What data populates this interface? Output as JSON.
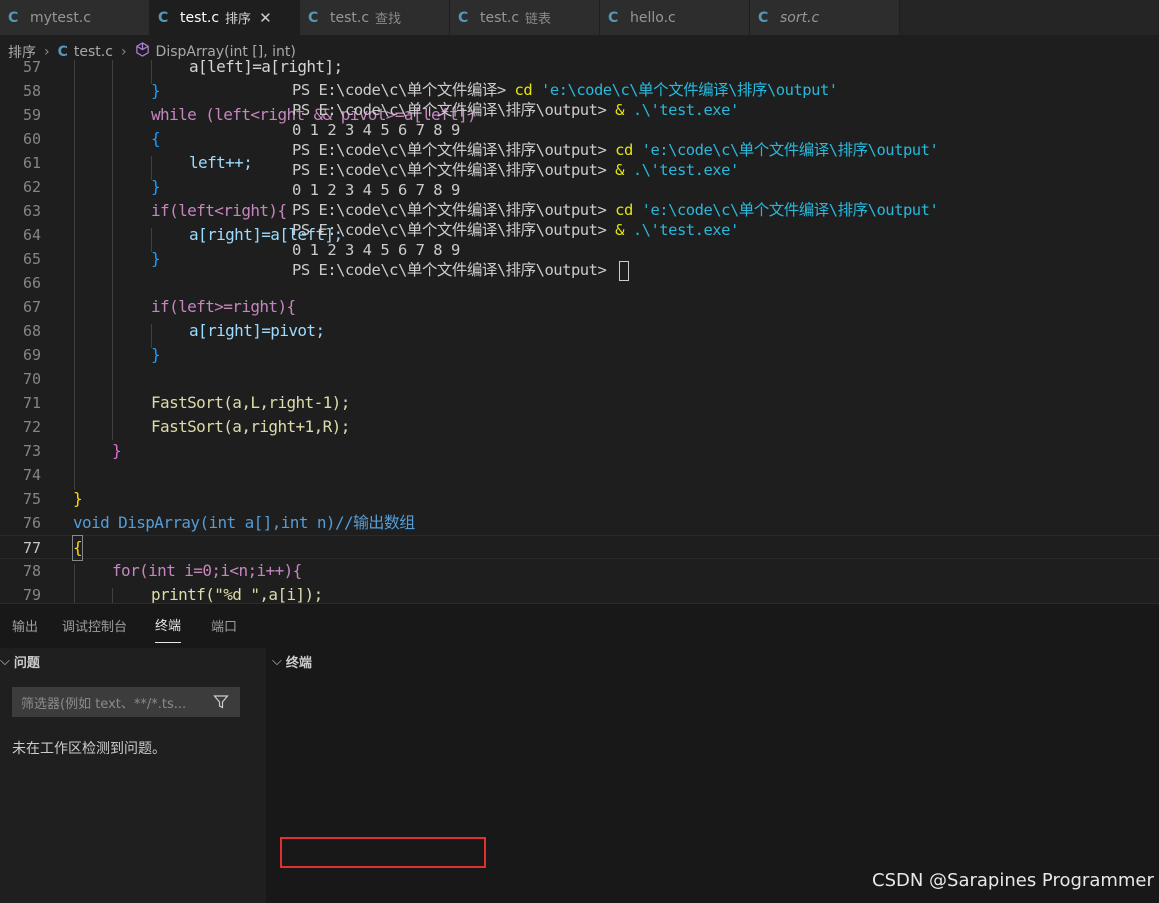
{
  "tabs": [
    {
      "icon": "C",
      "name": "mytest.c",
      "desc": "",
      "active": false,
      "italic": false
    },
    {
      "icon": "C",
      "name": "test.c",
      "desc": "排序",
      "active": true,
      "italic": false,
      "close": "✕"
    },
    {
      "icon": "C",
      "name": "test.c",
      "desc": "查找",
      "active": false,
      "italic": false
    },
    {
      "icon": "C",
      "name": "test.c",
      "desc": "链表",
      "active": false,
      "italic": false
    },
    {
      "icon": "C",
      "name": "hello.c",
      "desc": "",
      "active": false,
      "italic": false
    },
    {
      "icon": "C",
      "name": "sort.c",
      "desc": "",
      "active": false,
      "italic": true
    }
  ],
  "breadcrumb": {
    "folder": "排序",
    "file_icon": "C",
    "file": "test.c",
    "symbol": "DispArray(int [], int)"
  },
  "editor": {
    "line_numbers": [
      "57",
      "58",
      "59",
      "60",
      "61",
      "62",
      "63",
      "64",
      "65",
      "66",
      "67",
      "68",
      "69",
      "70",
      "71",
      "72",
      "73",
      "74",
      "75",
      "76",
      "77",
      "78",
      "79"
    ],
    "current_line": "77",
    "lines": [
      "a[left]=a[right];",
      "}",
      "while (left<right && pivot>=a[left])",
      "{",
      "left++;",
      "}",
      "if(left<right){",
      "a[right]=a[left];",
      "}",
      "",
      "if(left>=right){",
      "a[right]=pivot;",
      "}",
      "",
      "FastSort(a,L,right-1);",
      "FastSort(a,right+1,R);",
      "}",
      "",
      "}",
      "void DispArray(int a[],int n)//输出数组",
      "{",
      "for(int i=0;i<n;i++){",
      "printf(\"%d \",a[i]);"
    ]
  },
  "panel": {
    "tabs": [
      "输出",
      "调试控制台",
      "终端",
      "端口"
    ],
    "active_tab": "终端",
    "problems_header": "问题",
    "terminal_header": "终端",
    "filter_placeholder": "筛选器(例如 text、**/*.ts...",
    "no_problems": "未在工作区检测到问题。",
    "terminal_lines": [
      {
        "prompt": "PS E:\\code\\c\\单个文件编译> ",
        "cmd": "cd",
        "arg": " 'e:\\code\\c\\单个文件编译\\排序\\output'"
      },
      {
        "prompt": "PS E:\\code\\c\\单个文件编译\\排序\\output> ",
        "cmd": "&",
        "arg": " .\\'test.exe'"
      },
      {
        "prompt": "0 1 2 3 4 5 6 7 8 9",
        "cmd": "",
        "arg": ""
      },
      {
        "prompt": "PS E:\\code\\c\\单个文件编译\\排序\\output> ",
        "cmd": "cd",
        "arg": " 'e:\\code\\c\\单个文件编译\\排序\\output'"
      },
      {
        "prompt": "PS E:\\code\\c\\单个文件编译\\排序\\output> ",
        "cmd": "&",
        "arg": " .\\'test.exe'"
      },
      {
        "prompt": "0 1 2 3 4 5 6 7 8 9",
        "cmd": "",
        "arg": ""
      },
      {
        "prompt": "PS E:\\code\\c\\单个文件编译\\排序\\output> ",
        "cmd": "cd",
        "arg": " 'e:\\code\\c\\单个文件编译\\排序\\output'"
      },
      {
        "prompt": "PS E:\\code\\c\\单个文件编译\\排序\\output> ",
        "cmd": "&",
        "arg": " .\\'test.exe'"
      },
      {
        "prompt": "0 1 2 3 4 5 6 7 8 9",
        "cmd": "",
        "arg": ""
      },
      {
        "prompt": "PS E:\\code\\c\\单个文件编译\\排序\\output> ",
        "cmd": "",
        "arg": ""
      }
    ]
  },
  "watermark": "CSDN @Sarapines Programmer",
  "colors": {
    "highlight": "#e03131",
    "accent": "#519aba"
  }
}
